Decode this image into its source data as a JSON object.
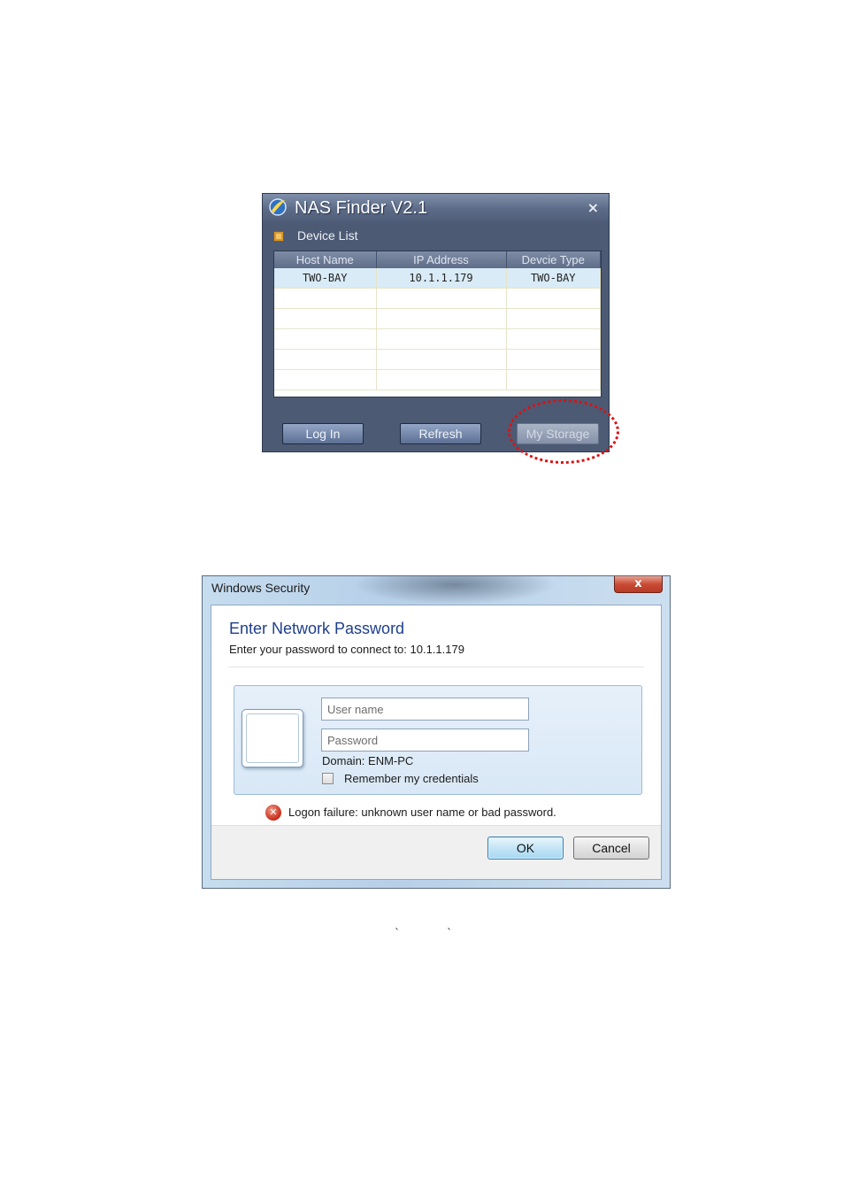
{
  "nas_finder": {
    "title": "NAS Finder V2.1",
    "close_glyph": "×",
    "section_label": "Device List",
    "columns": [
      "Host Name",
      "IP Address",
      "Devcie Type"
    ],
    "rows": [
      {
        "host": "TWO-BAY",
        "ip": "10.1.1.179",
        "type": "TWO-BAY"
      }
    ],
    "buttons": {
      "login": "Log In",
      "refresh": "Refresh",
      "my_storage": "My Storage"
    },
    "highlight_color": "#dd1111"
  },
  "windows_security": {
    "title": "Windows Security",
    "close_glyph": "x",
    "heading": "Enter Network Password",
    "subtitle": "Enter your password to connect to: 10.1.1.179",
    "username_placeholder": "User name",
    "password_placeholder": "Password",
    "domain": "Domain: ENM-PC",
    "remember_label": "Remember my credentials",
    "error_glyph": "✕",
    "error_message": "Logon failure: unknown user name or bad password.",
    "ok_label": "OK",
    "cancel_label": "Cancel",
    "heading_color": "#1e3f8c"
  },
  "stray_marks": [
    "`",
    "`"
  ]
}
